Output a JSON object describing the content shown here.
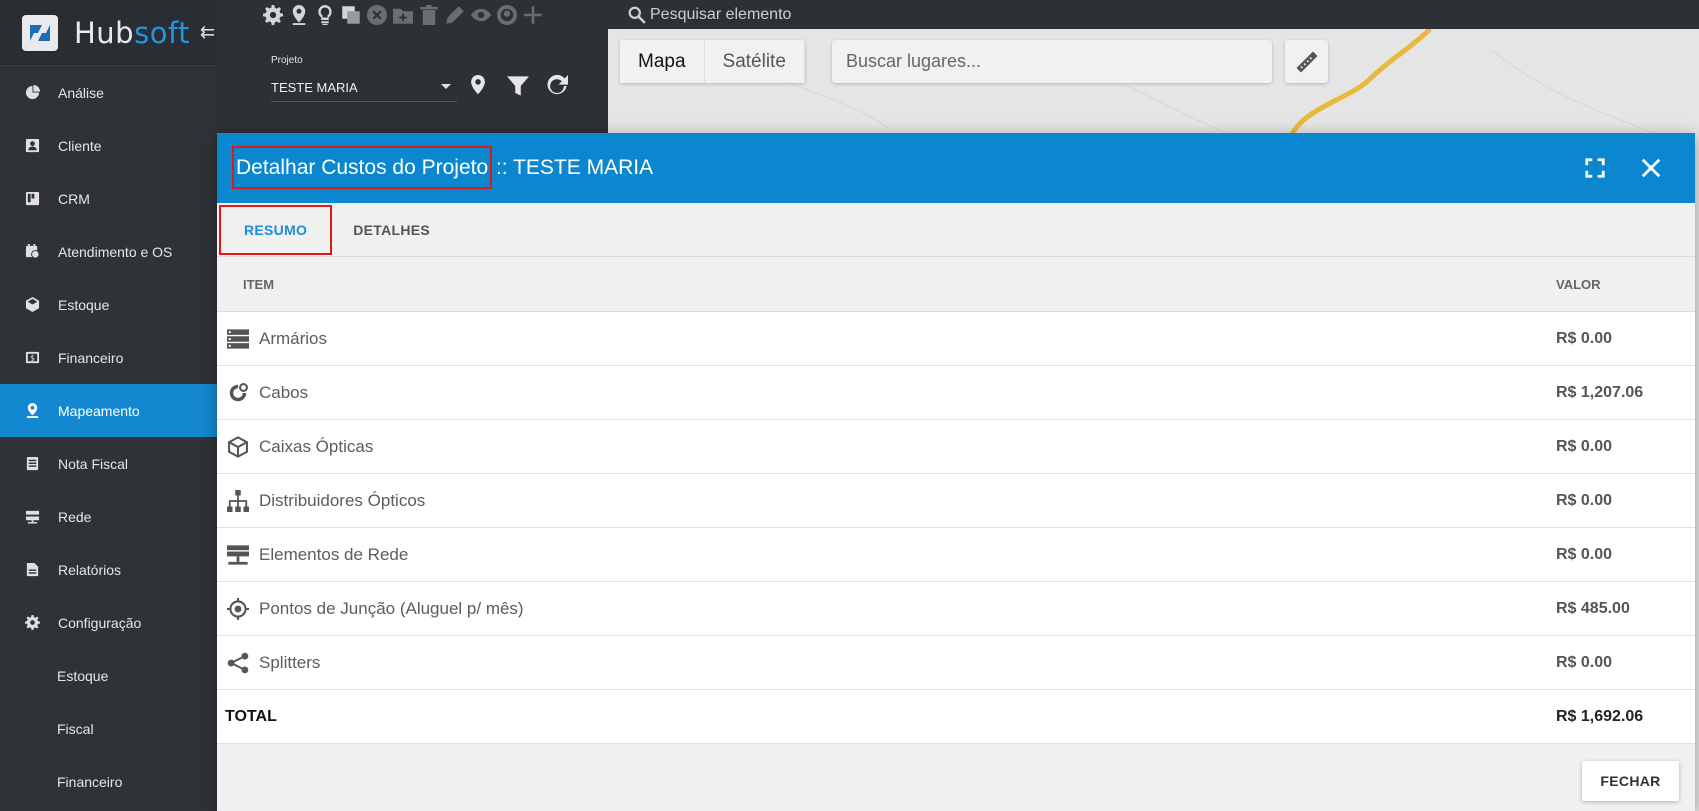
{
  "brand": {
    "hub": "Hub",
    "soft": "soft",
    "collapse_icon": "collapse-menu-icon"
  },
  "sidebar": {
    "items": [
      {
        "label": "Análise",
        "icon": "pie-chart-icon"
      },
      {
        "label": "Cliente",
        "icon": "contact-card-icon"
      },
      {
        "label": "CRM",
        "icon": "kanban-icon"
      },
      {
        "label": "Atendimento e OS",
        "icon": "calendar-clock-icon"
      },
      {
        "label": "Estoque",
        "icon": "box-icon"
      },
      {
        "label": "Financeiro",
        "icon": "dollar-icon"
      },
      {
        "label": "Mapeamento",
        "icon": "map-pin-icon",
        "active": true
      },
      {
        "label": "Nota Fiscal",
        "icon": "document-icon"
      },
      {
        "label": "Rede",
        "icon": "server-icon"
      },
      {
        "label": "Relatórios",
        "icon": "report-icon"
      },
      {
        "label": "Configuração",
        "icon": "gear-icon"
      }
    ],
    "subitems": [
      "Estoque",
      "Fiscal",
      "Financeiro"
    ]
  },
  "toolbar": {
    "icons": [
      "gear-icon",
      "map-marker-icon",
      "lightbulb-icon",
      "copy-icon",
      "remove-icon",
      "folder-add-icon",
      "trash-icon",
      "pencil-icon",
      "eye-icon",
      "location-icon",
      "plus-icon"
    ],
    "search_placeholder": "Pesquisar elemento"
  },
  "project": {
    "label": "Projeto",
    "value": "TESTE MARIA"
  },
  "map": {
    "type_map": "Mapa",
    "type_satellite": "Satélite",
    "search_placeholder": "Buscar lugares...",
    "road_color": "#e8b93c"
  },
  "modal": {
    "title_main": "Detalhar Custos do Projeto",
    "title_suffix": " :: TESTE MARIA",
    "header_color": "#0b87d0",
    "tabs": [
      {
        "label": "RESUMO",
        "active": true
      },
      {
        "label": "DETALHES",
        "active": false
      }
    ],
    "columns": {
      "item": "ITEM",
      "value": "VALOR"
    },
    "rows": [
      {
        "item": "Armários",
        "value": "R$ 0.00",
        "icon": "server-rack-icon"
      },
      {
        "item": "Cabos",
        "value": "R$ 1,207.06",
        "icon": "cable-reel-icon"
      },
      {
        "item": "Caixas Ópticas",
        "value": "R$ 0.00",
        "icon": "cube-icon"
      },
      {
        "item": "Distribuidores Ópticos",
        "value": "R$ 0.00",
        "icon": "hierarchy-icon"
      },
      {
        "item": "Elementos de Rede",
        "value": "R$ 0.00",
        "icon": "network-server-icon"
      },
      {
        "item": "Pontos de Junção (Aluguel p/ mês)",
        "value": "R$ 485.00",
        "icon": "crosshair-icon"
      },
      {
        "item": "Splitters",
        "value": "R$ 0.00",
        "icon": "share-icon"
      }
    ],
    "total": {
      "label": "TOTAL",
      "value": "R$ 1,692.06"
    },
    "close_button": "FECHAR"
  }
}
